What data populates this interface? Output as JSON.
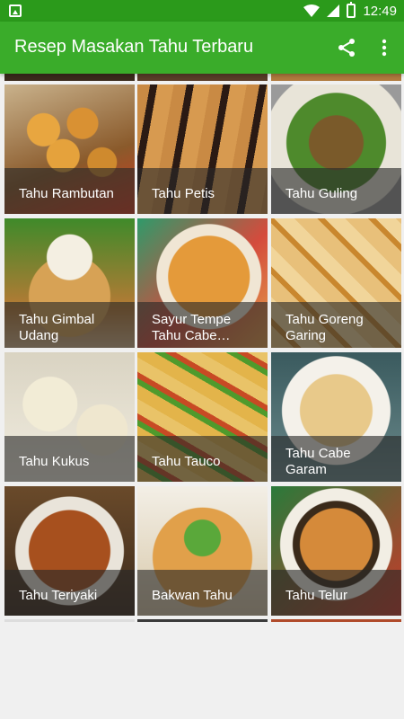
{
  "status_bar": {
    "time": "12:49",
    "icons": [
      "image-icon",
      "wifi-icon",
      "signal-icon",
      "battery-icon"
    ]
  },
  "app_bar": {
    "title": "Resep Masakan Tahu Terbaru",
    "share_icon": "share-icon",
    "menu_icon": "overflow-menu-icon"
  },
  "colors": {
    "status_bar": "#2b9a1b",
    "app_bar": "#3aac2a",
    "caption_overlay": "rgba(40,40,40,0.62)"
  },
  "recipes": [
    {
      "label": "Tahu Rambutan"
    },
    {
      "label": "Tahu Petis"
    },
    {
      "label": "Tahu Guling"
    },
    {
      "label": "Tahu Gimbal Udang"
    },
    {
      "label": "Sayur Tempe Tahu Cabe…"
    },
    {
      "label": "Tahu Goreng Garing"
    },
    {
      "label": "Tahu Kukus"
    },
    {
      "label": "Tahu Tauco"
    },
    {
      "label": "Tahu Cabe Garam"
    },
    {
      "label": "Tahu Teriyaki"
    },
    {
      "label": "Bakwan Tahu"
    },
    {
      "label": "Tahu Telur"
    }
  ]
}
